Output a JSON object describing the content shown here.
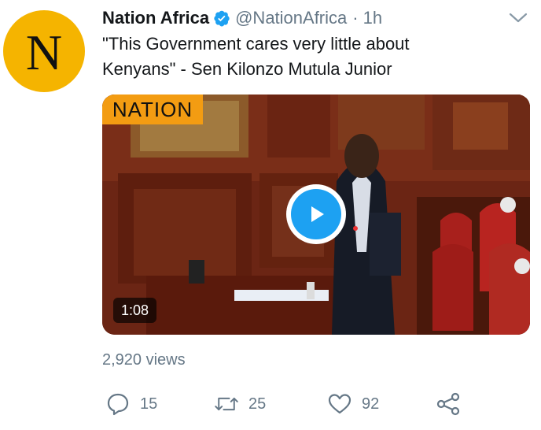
{
  "avatar": {
    "letter": "N"
  },
  "tweet": {
    "author_name": "Nation Africa",
    "handle": "@NationAfrica",
    "separator": "·",
    "time": "1h",
    "text": "\"This Government cares very little about Kenyans\" - Sen Kilonzo Mutula Junior"
  },
  "video": {
    "watermark": "NATION",
    "duration": "1:08",
    "play_icon": "play-icon"
  },
  "stats": {
    "views": "2,920 views"
  },
  "actions": {
    "reply_count": "15",
    "retweet_count": "25",
    "like_count": "92"
  },
  "colors": {
    "accent": "#1da1f2",
    "avatar_bg": "#f5b400",
    "secondary_text": "#657786",
    "watermark_bg": "#f39c12"
  }
}
